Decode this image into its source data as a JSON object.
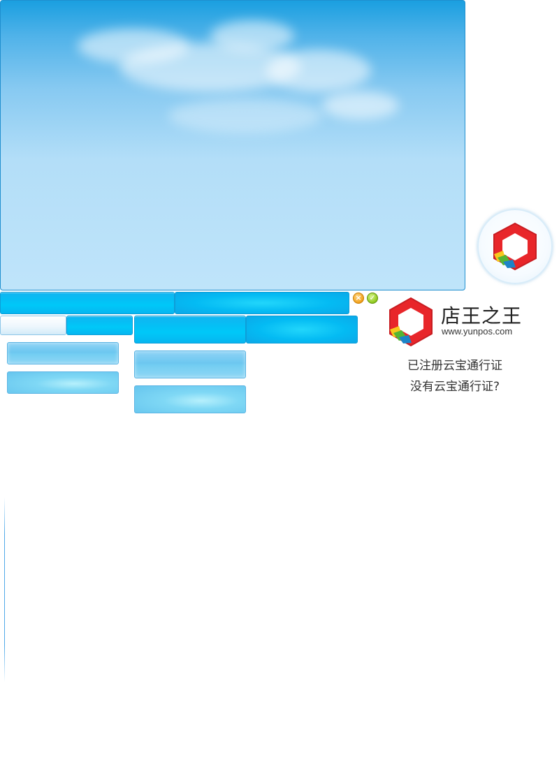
{
  "brand": {
    "name": "店王之王",
    "url": "www.yunpos.com"
  },
  "links": {
    "registered": "已注册云宝通行证",
    "no_account": "没有云宝通行证?"
  },
  "icons": {
    "close": "close-icon",
    "confirm": "check-icon",
    "logo": "hexagon-logo-icon"
  },
  "colors": {
    "sky_top": "#1a9fe0",
    "sky_bottom": "#bfe4fa",
    "button_blue": "#05bff5",
    "logo_red": "#e8262a"
  }
}
